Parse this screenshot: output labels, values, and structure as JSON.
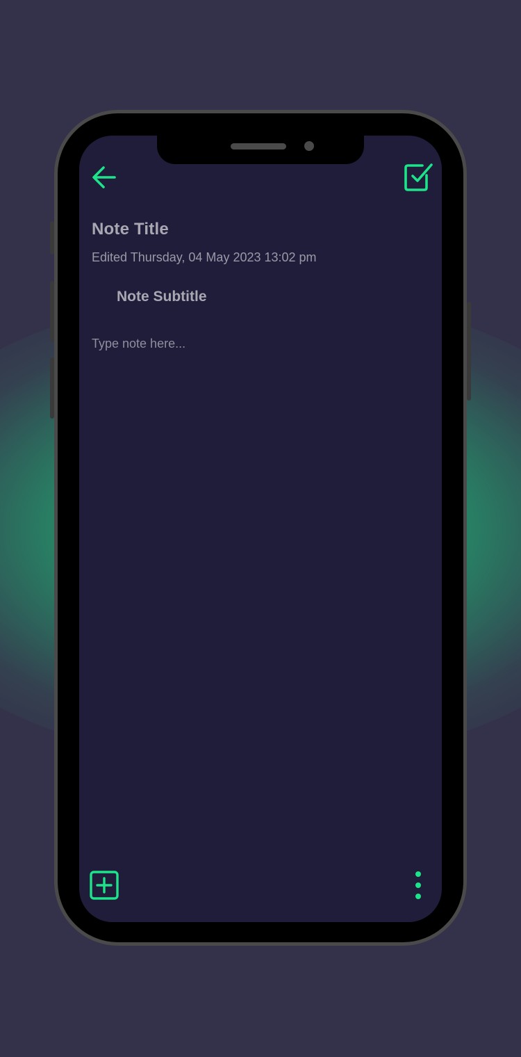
{
  "colors": {
    "accent": "#1de38b",
    "screen_background": "#1f1d3a",
    "page_background": "#34324a",
    "title_text": "#a9a8b2",
    "secondary_text": "#9a99a8"
  },
  "toolbar": {
    "back_icon": "arrow-left-icon",
    "save_icon": "checkbox-checked-icon"
  },
  "note": {
    "title": "Note Title",
    "edited": "Edited Thursday, 04 May 2023 13:02 pm",
    "subtitle": "Note Subtitle",
    "body_placeholder": "Type note here..."
  },
  "bottom_bar": {
    "add_icon": "plus-square-icon",
    "more_icon": "more-vertical-icon"
  }
}
